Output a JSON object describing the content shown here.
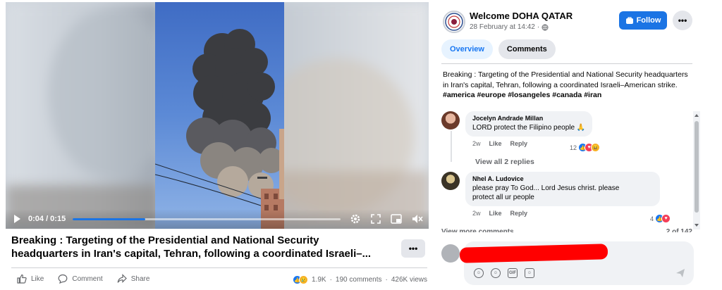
{
  "video": {
    "time_label": "0:04 / 0:15",
    "progress_fraction": 0.27
  },
  "post": {
    "title_line1": "Breaking : Targeting of the Presidential and National Security",
    "title_line2": "headquarters in Iran's capital, Tehran, following a coordinated Israeli–...",
    "more_label": "•••",
    "actions": {
      "like": "Like",
      "comment": "Comment",
      "share": "Share"
    },
    "stats": {
      "reactions": "1.9K",
      "comments": "190 comments",
      "views": "426K views",
      "separator": "·"
    }
  },
  "page": {
    "name": "Welcome DOHA QATAR",
    "date": "28 February at 14:42",
    "meta_separator": "·",
    "follow_label": "Follow",
    "more_label": "•••"
  },
  "tabs": [
    {
      "label": "Overview",
      "active": true
    },
    {
      "label": "Comments",
      "active": false
    }
  ],
  "description": {
    "text": "Breaking : Targeting of the Presidential and National Security headquarters in Iran's capital, Tehran, following a coordinated Israeli–American strike. ",
    "hashtags": "#america #europe #losangeles #canada #iran"
  },
  "comments": [
    {
      "author": "Jocelyn Andrade Millan",
      "text": "LORD protect the Filipino people 🙏",
      "time": "2w",
      "like": "Like",
      "reply": "Reply",
      "reaction_count": "12"
    },
    {
      "author": "Nhel A. Ludovice",
      "text_line1": "please pray To God... Lord Jesus christ. please",
      "text_line2": "protect all ur people",
      "time": "2w",
      "like": "Like",
      "reply": "Reply",
      "reaction_count": "4"
    }
  ],
  "view_replies": "View all 2 replies",
  "view_more": {
    "label": "View more comments",
    "count": "2 of 142"
  },
  "colors": {
    "accent": "#1b74e4",
    "redaction": "#ff0000"
  }
}
